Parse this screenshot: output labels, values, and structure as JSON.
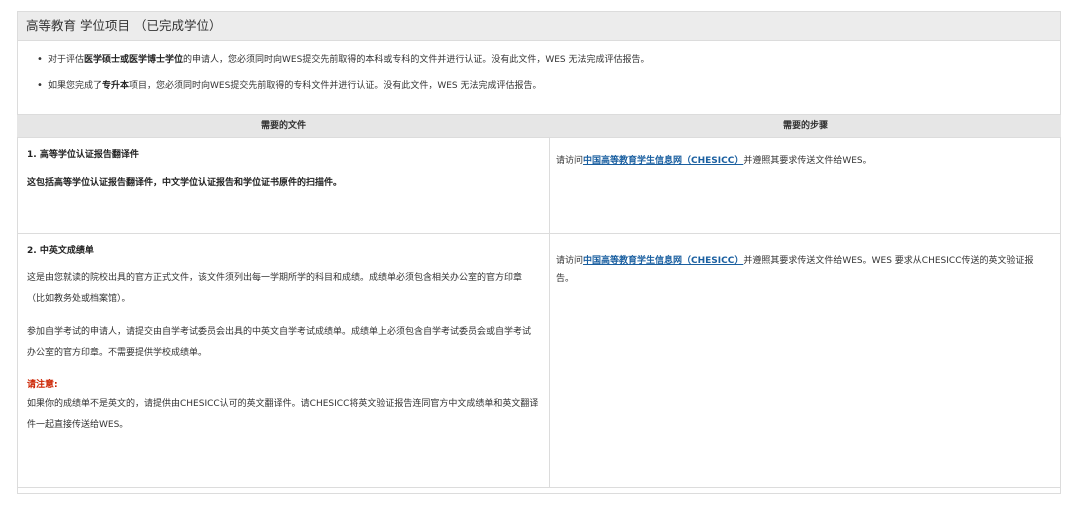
{
  "panel": {
    "title": "高等教育 学位项目 （已完成学位）"
  },
  "bullets": [
    {
      "pre": "对于评估",
      "bold1": "医学硕士或医学博士学位",
      "post": "的申请人，您必须同时向WES提交先前取得的本科或专科的文件并进行认证。没有此文件，WES 无法完成评估报告。"
    },
    {
      "pre": "如果您完成了",
      "bold1": "专升本",
      "post": "项目，您必须同时向WES提交先前取得的专科文件并进行认证。没有此文件，WES 无法完成评估报告。"
    }
  ],
  "table": {
    "headers": [
      "需要的文件",
      "需要的步骤"
    ],
    "rows": [
      {
        "doc_title": "1. 高等学位认证报告翻译件",
        "doc_sub": "这包括高等学位认证报告翻译件，中文学位认证报告和学位证书原件的扫描件。",
        "step_pre": "请访问",
        "step_link": "中国高等教育学生信息网（CHESICC）",
        "step_post": "并遵照其要求传送文件给WES。"
      },
      {
        "doc_title": "2. 中英文成绩单",
        "doc_p1": "这是由您就读的院校出具的官方正式文件，该文件须列出每一学期所学的科目和成绩。成绩单必须包含相关办公室的官方印章（比如教务处或档案馆）。",
        "doc_p2": "参加自学考试的申请人，请提交由自学考试委员会出具的中英文自学考试成绩单。成绩单上必须包含自学考试委员会或自学考试办公室的官方印章。不需要提供学校成绩单。",
        "warn_label": "请注意:",
        "doc_p3": "如果你的成绩单不是英文的，请提供由CHESICC认可的英文翻译件。请CHESICC将英文验证报告连同官方中文成绩单和英文翻译件一起直接传送给WES。",
        "step_pre": "请访问",
        "step_link": "中国高等教育学生信息网（CHESICC）",
        "step_post": "并遵照其要求传送文件给WES。WES 要求从CHESICC传送的英文验证报告。"
      }
    ]
  },
  "colors": {
    "link": "#1a5fa0",
    "warning": "#cc2200",
    "header_bg": "#ececec"
  }
}
